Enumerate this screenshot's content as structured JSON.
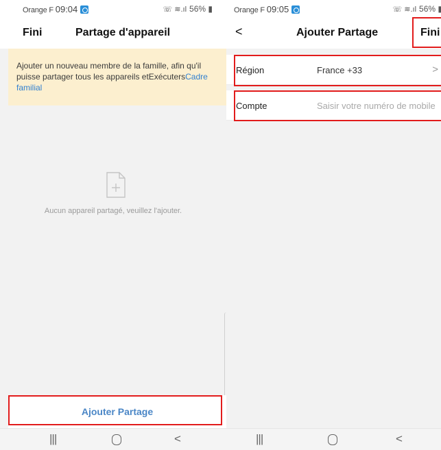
{
  "left": {
    "status": {
      "carrier": "Orange F",
      "time": "09:04",
      "battery": "56%"
    },
    "nav": {
      "title": "Partage d'appareil",
      "left_button": "Fini"
    },
    "banner": {
      "text": "Ajouter un nouveau membre de la famille, afin qu'il puisse partager tous les appareils etExécuters",
      "link": "Cadre familial"
    },
    "empty_state": {
      "icon": "add-file-icon",
      "message": "Aucun appareil partagé, veuillez l'ajouter."
    },
    "add_button": "Ajouter Partage"
  },
  "right": {
    "status": {
      "carrier": "Orange F",
      "time": "09:05",
      "battery": "56%"
    },
    "nav": {
      "back_icon": "back-chevron-icon",
      "back_glyph": "<",
      "title": "Ajouter Partage",
      "right_button": "Fini"
    },
    "form": {
      "region": {
        "label": "Région",
        "value": "France +33"
      },
      "account": {
        "label": "Compte",
        "placeholder": "Saisir votre numéro de mobile"
      }
    }
  },
  "system_nav": {
    "recents": "|||",
    "back": "<"
  },
  "colors": {
    "highlight": "#e21b1b",
    "accent": "#4a86c6",
    "banner_bg": "#fcefcf",
    "link": "#2f7fd0"
  }
}
